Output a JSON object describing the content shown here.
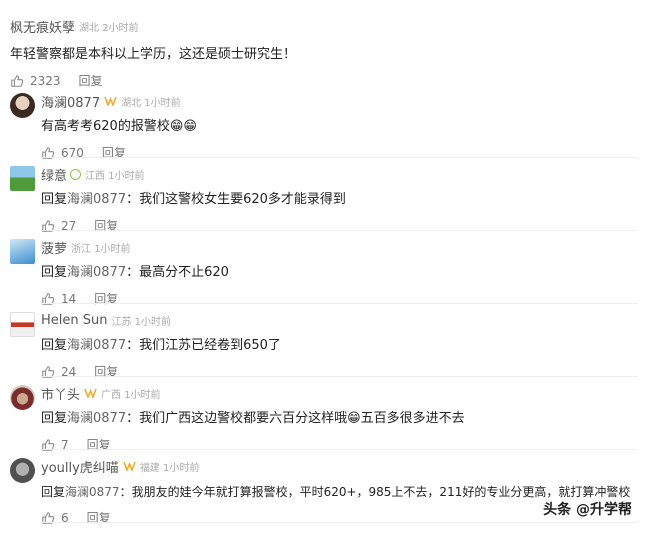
{
  "top_comment": {
    "username": "枫无痕妖孽",
    "location_time": "湖北 2小时前",
    "text": "年轻警察都是本科以上学历，这还是硕士研究生！",
    "likes": "2323",
    "reply_label": "回复"
  },
  "replies": [
    {
      "username": "海澜0877",
      "location_time": "湖北 1小时前",
      "vip": true,
      "text": "有高考考620的报警校😁😁",
      "likes": "670",
      "reply_label": "回复"
    },
    {
      "username": "绿意",
      "location_time": "江西 1小时前",
      "vip": false,
      "badge": true,
      "prefix": "回复",
      "mention": "海澜0877",
      "text": "：我们这警校女生要620多才能录得到",
      "likes": "27",
      "reply_label": "回复"
    },
    {
      "username": "菠萝",
      "location_time": "浙江 1小时前",
      "vip": false,
      "prefix": "回复",
      "mention": "海澜0877",
      "text": "：最高分不止620",
      "likes": "14",
      "reply_label": "回复"
    },
    {
      "username": "Helen Sun",
      "location_time": "江苏 1小时前",
      "vip": false,
      "prefix": "回复",
      "mention": "海澜0877",
      "text": "：我们江苏已经卷到650了",
      "likes": "24",
      "reply_label": "回复"
    },
    {
      "username": "市丫头",
      "location_time": "广西 1小时前",
      "vip": true,
      "prefix": "回复",
      "mention": "海澜0877",
      "text": "：我们广西这边警校都要六百分这样哦😁五百多很多进不去",
      "likes": "7",
      "reply_label": "回复"
    },
    {
      "username": "yoully虎纠喵",
      "location_time": "福建 1小时前",
      "vip": true,
      "prefix": "回复",
      "mention": "海澜0877",
      "text": "：我朋友的娃今年就打算报警校，平时620+，985上不去，211好的专业分更高，就打算冲警校",
      "likes": "6",
      "reply_label": "回复"
    }
  ],
  "watermark": "头条 @升学帮",
  "colors": {
    "vip": "#f5a623",
    "muted": "#aaaaaa",
    "text": "#222222"
  }
}
